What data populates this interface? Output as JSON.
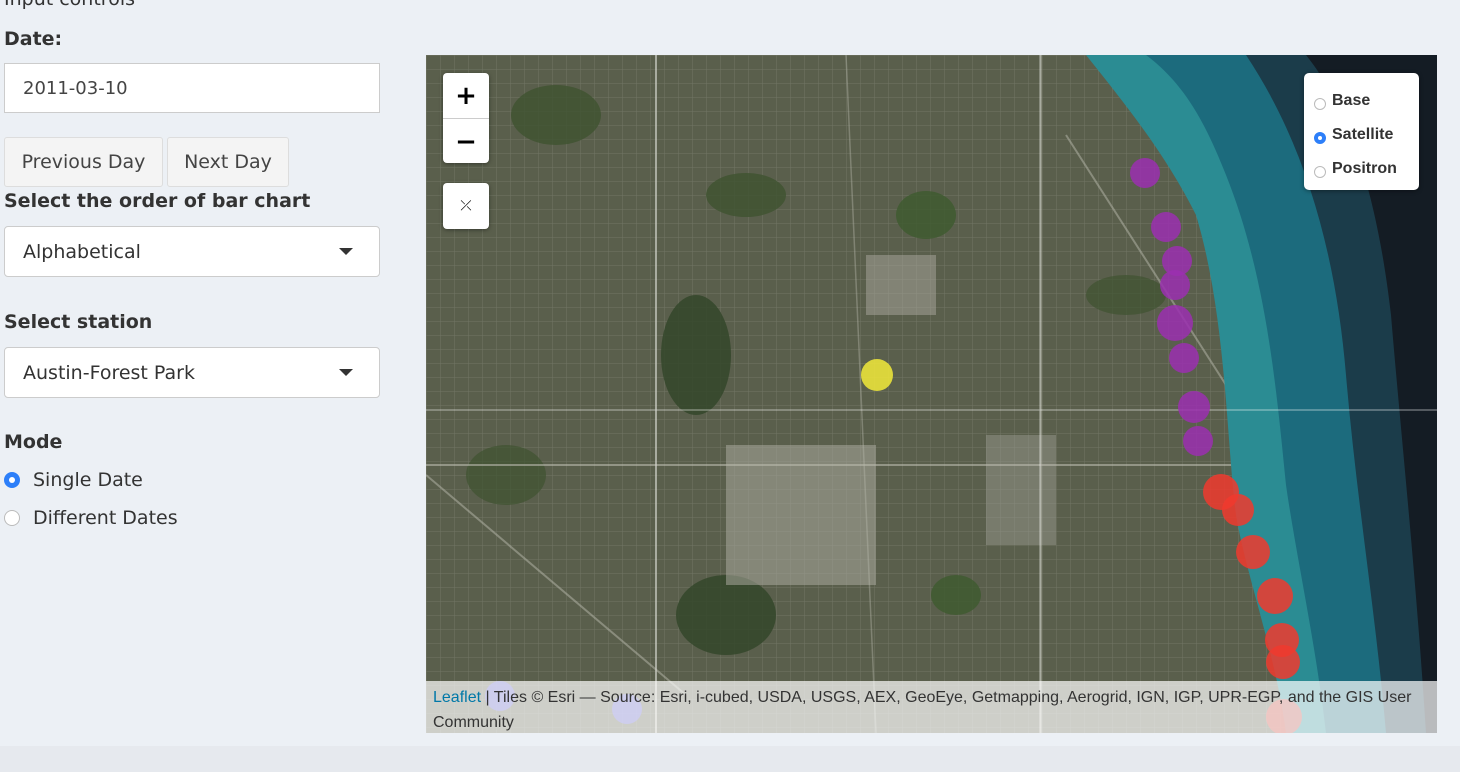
{
  "sidebar": {
    "heading": "Input controls",
    "date_label": "Date:",
    "date_value": "2011-03-10",
    "prev_label": "Previous Day",
    "next_label": "Next Day",
    "order_label": "Select the order of bar chart",
    "order_value": "Alphabetical",
    "station_label": "Select station",
    "station_value": "Austin-Forest Park",
    "mode_label": "Mode",
    "mode_options": [
      "Single Date",
      "Different Dates"
    ],
    "mode_selected": "Single Date"
  },
  "map": {
    "zoom_in": "+",
    "zoom_out": "−",
    "reset_icon": "fullscreen-exit-icon",
    "layers": [
      "Base",
      "Satellite",
      "Positron"
    ],
    "layer_selected": "Satellite",
    "attribution_link": "Leaflet",
    "attribution_text": " | Tiles © Esri — Source: Esri, i-cubed, USDA, USGS, AEX, GeoEye, Getmapping, Aerogrid, IGN, IGP, UPR-EGP, and the GIS User Community",
    "marker_colors": {
      "purple": "#9b2fb0",
      "red": "#f03a2e",
      "yellow": "#f2ea3a",
      "blue": "#5b5bf0"
    }
  }
}
